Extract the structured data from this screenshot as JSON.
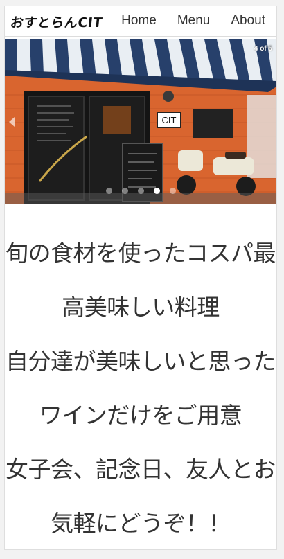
{
  "header": {
    "brand": "おすとらんCIT",
    "nav": [
      "Home",
      "Menu",
      "About"
    ]
  },
  "carousel": {
    "counter": "4 of 5",
    "sign_text": "CIT",
    "slide_count": 5,
    "active_index": 3
  },
  "main": {
    "lines": [
      "旬の食材を使ったコスパ最",
      "高美味しい料理",
      "自分達が美味しいと思った",
      "ワインだけをご用意",
      "女子会、記念日、友人とお",
      "気軽にどうぞ！！"
    ]
  }
}
